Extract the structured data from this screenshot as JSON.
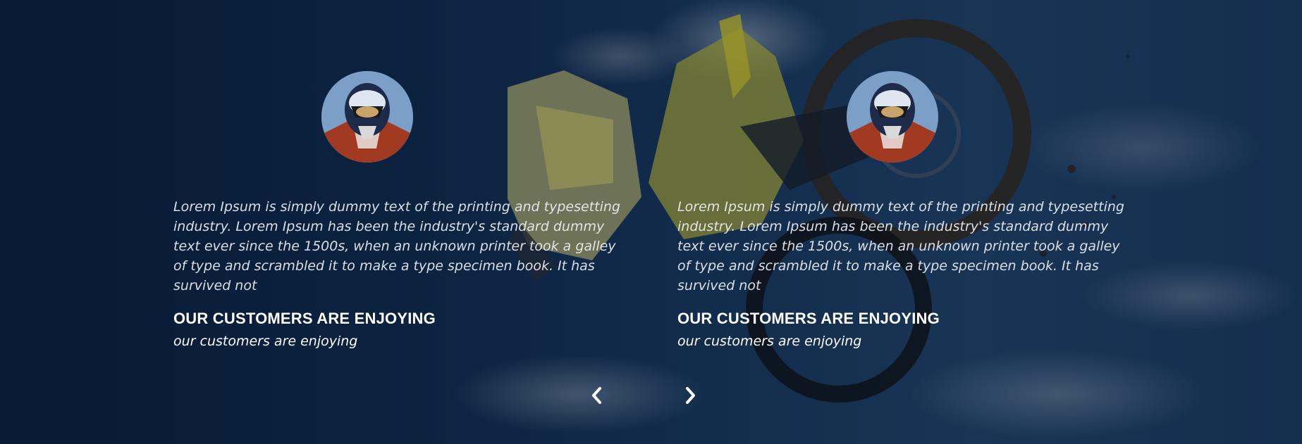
{
  "testimonials": [
    {
      "avatar_icon": "avatar-rider",
      "quote": "Lorem Ipsum is simply dummy text of the printing and typesetting industry. Lorem Ipsum has been the industry's standard dummy text ever since the 1500s, when an unknown printer took a galley of type and scrambled it to make a type specimen book. It has survived not",
      "name": "OUR CUSTOMERS ARE ENJOYING",
      "role": "our customers are enjoying"
    },
    {
      "avatar_icon": "avatar-rider",
      "quote": "Lorem Ipsum is simply dummy text of the printing and typesetting industry. Lorem Ipsum has been the industry's standard dummy text ever since the 1500s, when an unknown printer took a galley of type and scrambled it to make a type specimen book. It has survived not",
      "name": "OUR CUSTOMERS ARE ENJOYING",
      "role": "our customers are enjoying"
    }
  ],
  "navigation": {
    "prev_icon": "chevron-left-icon",
    "next_icon": "chevron-right-icon"
  },
  "colors": {
    "text": "#ffffff",
    "sky_dark": "#0a1e3b",
    "sky_light": "#24466d"
  }
}
